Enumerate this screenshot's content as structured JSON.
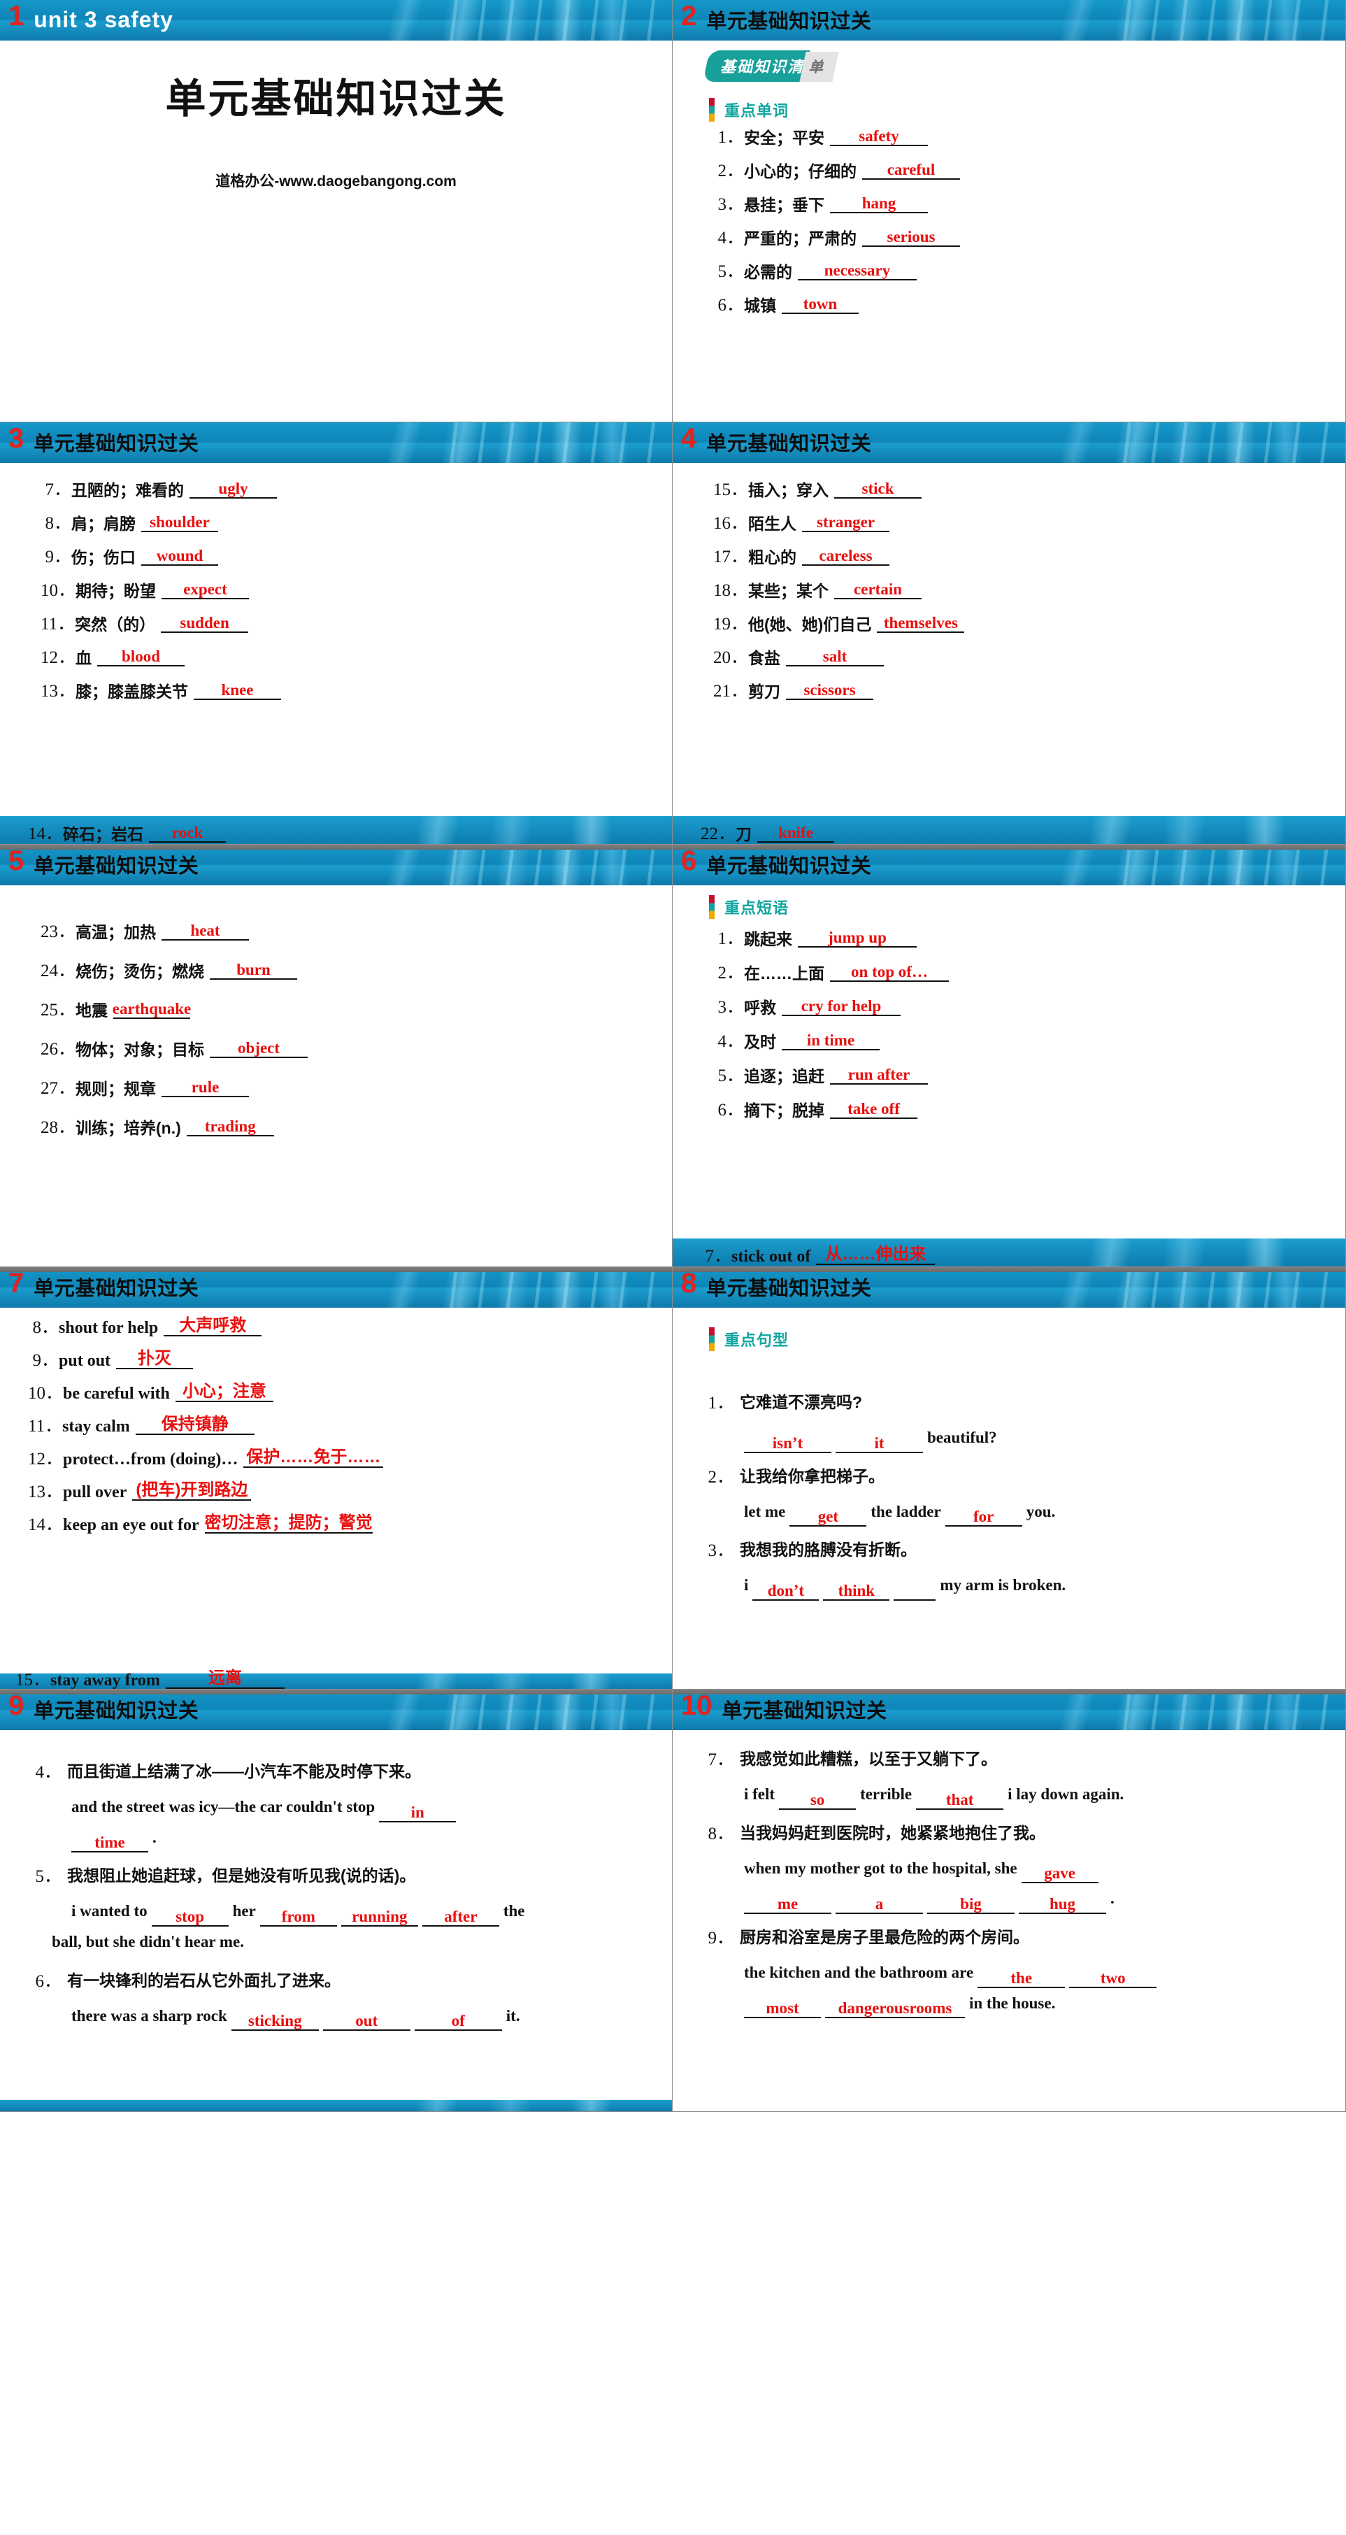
{
  "deck": {
    "watermark": "道格办公-www.daogebangong.com",
    "header_title": "单元基础知识过关",
    "cover_unit": "unit 3  safety",
    "cover_title": "单元基础知识过关",
    "badge_teal": "基础知识清",
    "badge_grey": "单",
    "section_words": "重点单词",
    "section_phrases": "重点短语",
    "section_sentences": "重点句型",
    "accent_red": "#e8100f",
    "accent_teal": "#12a5a0",
    "band_blue": "#0f85b8"
  },
  "slides": [
    {
      "num": "1"
    },
    {
      "num": "2"
    },
    {
      "num": "3"
    },
    {
      "num": "4"
    },
    {
      "num": "5"
    },
    {
      "num": "6"
    },
    {
      "num": "7"
    },
    {
      "num": "8"
    },
    {
      "num": "9"
    },
    {
      "num": "10"
    }
  ],
  "words": [
    {
      "n": "1．",
      "cn": "安全；平安",
      "ans": "safety"
    },
    {
      "n": "2．",
      "cn": "小心的；仔细的",
      "ans": "careful"
    },
    {
      "n": "3．",
      "cn": "悬挂；垂下",
      "ans": "hang"
    },
    {
      "n": "4．",
      "cn": "严重的；严肃的",
      "ans": "serious"
    },
    {
      "n": "5．",
      "cn": "必需的",
      "ans": "necessary"
    },
    {
      "n": "6．",
      "cn": "城镇",
      "ans": "town"
    },
    {
      "n": "7．",
      "cn": "丑陋的；难看的",
      "ans": "ugly"
    },
    {
      "n": "8．",
      "cn": "肩；肩膀",
      "ans": "shoulder"
    },
    {
      "n": "9．",
      "cn": "伤；伤口",
      "ans": "wound"
    },
    {
      "n": "10．",
      "cn": "期待；盼望",
      "ans": "expect"
    },
    {
      "n": "11．",
      "cn": "突然（的）",
      "ans": "sudden"
    },
    {
      "n": "12．",
      "cn": "血",
      "ans": "blood"
    },
    {
      "n": "13．",
      "cn": "膝；膝盖膝关节",
      "ans": "knee"
    },
    {
      "n": "14．",
      "cn": "碎石；岩石",
      "ans": "rock"
    },
    {
      "n": "15．",
      "cn": "插入；穿入",
      "ans": "stick"
    },
    {
      "n": "16．",
      "cn": "陌生人",
      "ans": "stranger"
    },
    {
      "n": "17．",
      "cn": "粗心的",
      "ans": "careless"
    },
    {
      "n": "18．",
      "cn": "某些；某个",
      "ans": "certain"
    },
    {
      "n": "19．",
      "cn": "他(她、她)们自己",
      "ans": "themselves"
    },
    {
      "n": "20．",
      "cn": "食盐",
      "ans": "salt"
    },
    {
      "n": "21．",
      "cn": "剪刀",
      "ans": "scissors"
    },
    {
      "n": "22．",
      "cn": "刀",
      "ans": "knife"
    },
    {
      "n": "23．",
      "cn": "高温；加热",
      "ans": "heat"
    },
    {
      "n": "24．",
      "cn": "烧伤；烫伤；燃烧",
      "ans": "burn"
    },
    {
      "n": "25．",
      "cn": "地震",
      "ans": "earthquake"
    },
    {
      "n": "26．",
      "cn": "物体；对象；目标",
      "ans": "object"
    },
    {
      "n": "27．",
      "cn": "规则；规章",
      "ans": "rule"
    },
    {
      "n": "28．",
      "cn": "训练；培养(n.)",
      "ans": "trading"
    }
  ],
  "phrases": [
    {
      "n": "1．",
      "cn": "跳起来",
      "ans": "jump up"
    },
    {
      "n": "2．",
      "cn": "在……上面",
      "ans": "on top of…"
    },
    {
      "n": "3．",
      "cn": "呼救",
      "ans": "cry for help"
    },
    {
      "n": "4．",
      "cn": "及时",
      "ans": "in time"
    },
    {
      "n": "5．",
      "cn": "追逐；追赶",
      "ans": "run after"
    },
    {
      "n": "6．",
      "cn": "摘下；脱掉",
      "ans": "take off"
    },
    {
      "n": "7．",
      "en": "stick out of",
      "ans": "从……伸出来"
    },
    {
      "n": "8．",
      "en": "shout for help",
      "ans": "大声呼救"
    },
    {
      "n": "9．",
      "en": "put out",
      "ans": "扑灭"
    },
    {
      "n": "10．",
      "en": "be careful with",
      "ans": "小心；注意"
    },
    {
      "n": "11．",
      "en": "stay calm",
      "ans": "保持镇静"
    },
    {
      "n": "12．",
      "en": "protect…from (doing)…",
      "ans": "保护……免于……"
    },
    {
      "n": "13．",
      "en": "pull over",
      "ans": "(把车)开到路边"
    },
    {
      "n": "14．",
      "en": "keep an eye out for",
      "ans": "密切注意；提防；警觉"
    },
    {
      "n": "15．",
      "en": "stay away from",
      "ans": "远离"
    }
  ],
  "sentences": [
    {
      "n": "1．",
      "cn": "它难道不漂亮吗?",
      "parts": [
        {
          "type": "blank",
          "ans": "isn’t",
          "w": "w125"
        },
        {
          "type": "blank",
          "ans": "it",
          "w": "w125"
        },
        {
          "type": "text",
          "t": "beautiful?"
        }
      ]
    },
    {
      "n": "2．",
      "cn": "让我给你拿把梯子。",
      "parts": [
        {
          "type": "text",
          "t": "let me"
        },
        {
          "type": "blank",
          "ans": "get",
          "w": "w110"
        },
        {
          "type": "text",
          "t": "the ladder"
        },
        {
          "type": "blank",
          "ans": "for",
          "w": "w110"
        },
        {
          "type": "text",
          "t": "you."
        }
      ]
    },
    {
      "n": "3．",
      "cn": "我想我的胳膊没有折断。",
      "parts": [
        {
          "type": "text",
          "t": "i"
        },
        {
          "type": "blank",
          "ans": "don’t",
          "w": "w95"
        },
        {
          "type": "blank",
          "ans": "think",
          "w": "w95"
        },
        {
          "type": "blank",
          "ans": "",
          "w": "w60"
        },
        {
          "type": "text",
          "t": "my arm is broken."
        }
      ]
    },
    {
      "n": "4．",
      "cn": "而且街道上结满了冰——小汽车不能及时停下来。",
      "parts": [
        {
          "type": "text",
          "t": "and the street was icy—the car couldn't stop"
        },
        {
          "type": "blank",
          "ans": "in",
          "w": "w110"
        },
        {
          "type": "break"
        },
        {
          "type": "blank",
          "ans": "time",
          "w": "w110"
        },
        {
          "type": "text",
          "t": "."
        }
      ]
    },
    {
      "n": "5．",
      "cn": "我想阻止她追赶球，但是她没有听见我(说的话)。",
      "parts": [
        {
          "type": "text",
          "t": "i wanted to"
        },
        {
          "type": "blank",
          "ans": "stop",
          "w": "w110"
        },
        {
          "type": "text",
          "t": "her"
        },
        {
          "type": "blank",
          "ans": "from",
          "w": "w110"
        },
        {
          "type": "blank",
          "ans": "running",
          "w": "w110"
        },
        {
          "type": "blank",
          "ans": "after",
          "w": "w110"
        },
        {
          "type": "text",
          "t": "the"
        },
        {
          "type": "break"
        },
        {
          "type": "text",
          "t": "ball, but she didn't hear me."
        }
      ]
    },
    {
      "n": "6．",
      "cn": "有一块锋利的岩石从它外面扎了进来。",
      "parts": [
        {
          "type": "text",
          "t": "there was a sharp rock"
        },
        {
          "type": "blank",
          "ans": "sticking",
          "w": "w125"
        },
        {
          "type": "blank",
          "ans": "out",
          "w": "w125"
        },
        {
          "type": "blank",
          "ans": "of",
          "w": "w125"
        },
        {
          "type": "text",
          "t": "it."
        }
      ]
    },
    {
      "n": "7．",
      "cn": "我感觉如此糟糕，以至于又躺下了。",
      "parts": [
        {
          "type": "text",
          "t": "i felt"
        },
        {
          "type": "blank",
          "ans": "so",
          "w": "w110"
        },
        {
          "type": "text",
          "t": "terrible"
        },
        {
          "type": "blank",
          "ans": "that",
          "w": "w125"
        },
        {
          "type": "text",
          "t": "i lay down again."
        }
      ]
    },
    {
      "n": "8．",
      "cn": "当我妈妈赶到医院时，她紧紧地抱住了我。",
      "parts": [
        {
          "type": "text",
          "t": "when my mother got to the hospital, she"
        },
        {
          "type": "blank",
          "ans": "gave",
          "w": "w110"
        },
        {
          "type": "break"
        },
        {
          "type": "blank",
          "ans": "me",
          "w": "w125"
        },
        {
          "type": "blank",
          "ans": "a",
          "w": "w125"
        },
        {
          "type": "blank",
          "ans": "big",
          "w": "w125"
        },
        {
          "type": "blank",
          "ans": "hug",
          "w": "w125"
        },
        {
          "type": "text",
          "t": "."
        }
      ]
    },
    {
      "n": "9．",
      "cn": "厨房和浴室是房子里最危险的两个房间。",
      "parts": [
        {
          "type": "text",
          "t": "the kitchen and the bathroom are"
        },
        {
          "type": "blank",
          "ans": "the",
          "w": "w125"
        },
        {
          "type": "blank",
          "ans": "two",
          "w": "w125"
        },
        {
          "type": "break"
        },
        {
          "type": "blank",
          "ans": "most",
          "w": "w110"
        },
        {
          "type": "blank",
          "ans": "dangerousrooms",
          "w": "w200"
        },
        {
          "type": "text",
          "t": "in the house."
        }
      ]
    }
  ]
}
